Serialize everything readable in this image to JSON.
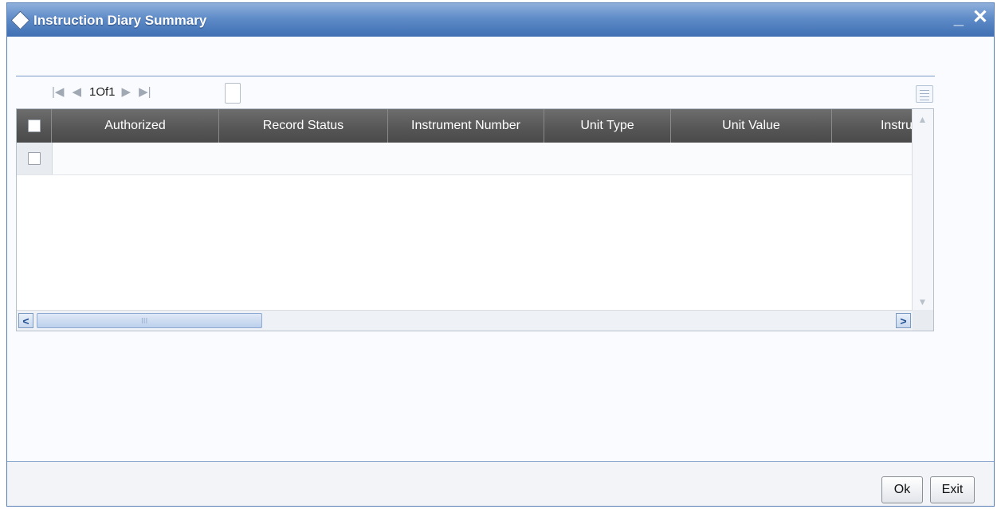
{
  "window": {
    "title": "Instruction Diary Summary",
    "minimize_glyph": "_",
    "close_glyph": "✕"
  },
  "pager": {
    "first_glyph": "|◀",
    "prev_glyph": "◀",
    "page_text": "1Of1",
    "next_glyph": "▶",
    "last_glyph": "▶|"
  },
  "grid": {
    "columns": [
      {
        "label": "Authorized"
      },
      {
        "label": "Record Status"
      },
      {
        "label": "Instrument Number"
      },
      {
        "label": "Unit Type"
      },
      {
        "label": "Unit Value"
      },
      {
        "label": "Instru"
      }
    ],
    "scroll_left_glyph": "<",
    "scroll_right_glyph": ">",
    "scroll_grip_glyph": "III"
  },
  "footer": {
    "ok_label": "Ok",
    "exit_label": "Exit"
  },
  "colors": {
    "titlebar": "#4f7fc0",
    "grid_header": "#5a5a5a",
    "accent_border": "#5a7fb6"
  }
}
